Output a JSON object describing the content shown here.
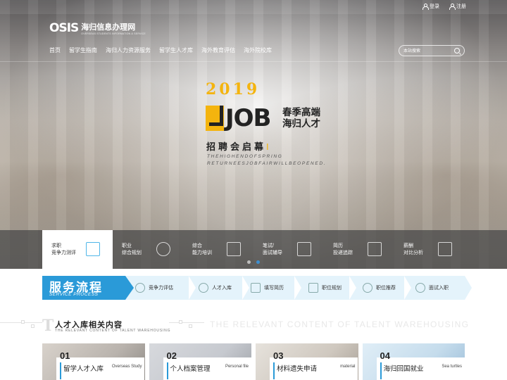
{
  "top_links": {
    "login": "登录",
    "register": "注册"
  },
  "logo": {
    "mark": "OSIS",
    "name_cn": "海归信息办理网",
    "name_en": "OVERSEAS STUDENTS INFORMATION & SERVICE"
  },
  "nav": [
    "首页",
    "留学生指南",
    "海归人力资源服务",
    "留学生人才库",
    "海外教育评估",
    "海外院校库"
  ],
  "search": {
    "placeholder": "本站搜索"
  },
  "banner": {
    "year": "2019",
    "job": "JOB",
    "tag_line1": "春季高端",
    "tag_line2": "海归人才",
    "title": "招聘会启幕",
    "cursor": "I",
    "en_line1": "THEHIGHENDOFSPRING",
    "en_line2": "RETURNEESJOBFAIRWILLBEOPENED."
  },
  "service_strip": [
    {
      "l1": "求职",
      "l2": "竞争力测评",
      "icon": "checklist-icon",
      "active": true
    },
    {
      "l1": "职业",
      "l2": "综合规划",
      "icon": "pie-chart-icon",
      "active": false
    },
    {
      "l1": "综合",
      "l2": "能力培训",
      "icon": "document-icon",
      "active": false
    },
    {
      "l1": "笔试/",
      "l2": "面试辅导",
      "icon": "edit-icon",
      "active": false
    },
    {
      "l1": "简历",
      "l2": "投递追踪",
      "icon": "presentation-icon",
      "active": false
    },
    {
      "l1": "薪酬",
      "l2": "对比分析",
      "icon": "bar-chart-icon",
      "active": false
    }
  ],
  "carousel": {
    "active_index": 1,
    "count": 2
  },
  "process": {
    "title_cn": "服务流程",
    "title_en": "SERVICE PROCESS",
    "steps": [
      {
        "label": "竞争力评估",
        "icon": "user-assess-icon"
      },
      {
        "label": "人才入库",
        "icon": "target-icon"
      },
      {
        "label": "填写简历",
        "icon": "pen-icon"
      },
      {
        "label": "职位规划",
        "icon": "chart-board-icon"
      },
      {
        "label": "职位推荐",
        "icon": "handshake-icon"
      },
      {
        "label": "面试入职",
        "icon": "person-tie-icon"
      }
    ]
  },
  "section": {
    "letter": "T",
    "title_cn": "人才入库相关内容",
    "title_en": "THE RELEVANT CONTENT OF TALENT WAREHOUSING",
    "bg_text": "THE RELEVANT CONTENT OF TALENT WAREHOUSING"
  },
  "cards": [
    {
      "num": "01",
      "cn": "留学人才入库",
      "en": "Overseas Study"
    },
    {
      "num": "02",
      "cn": "个人档案管理",
      "en": "Personal file"
    },
    {
      "num": "03",
      "cn": "材料遗失申请",
      "en": "material"
    },
    {
      "num": "04",
      "cn": "海归回国就业",
      "en": "Sea turtles"
    }
  ]
}
